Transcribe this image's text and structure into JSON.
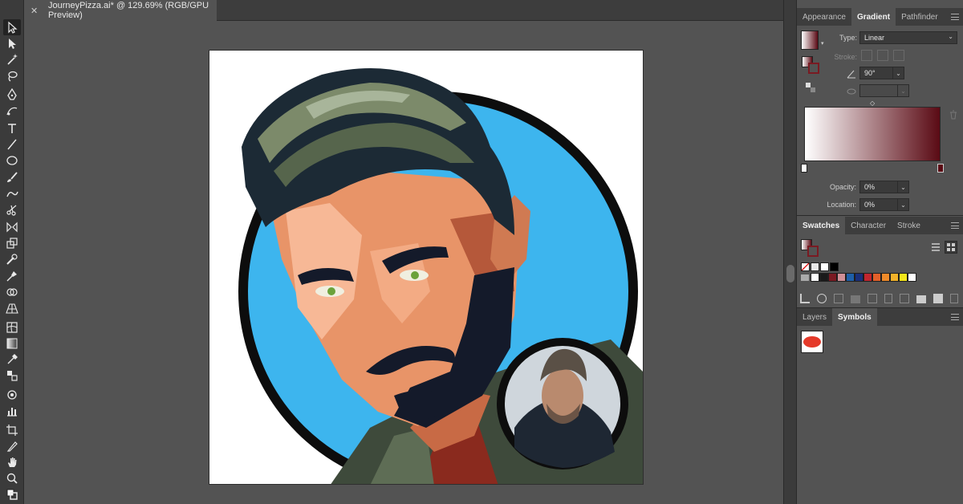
{
  "document": {
    "tab_title": "JourneyPizza.ai* @ 129.69% (RGB/GPU Preview)",
    "close_glyph": "✕"
  },
  "toolbar": {
    "tools": [
      "selection-tool-icon",
      "direct-selection-tool-icon",
      "magic-wand-tool-icon",
      "lasso-tool-icon",
      "pen-tool-icon",
      "curvature-tool-icon",
      "type-tool-icon",
      "line-segment-tool-icon",
      "ellipse-tool-icon",
      "paintbrush-tool-icon",
      "shaper-tool-icon",
      "scissors-tool-icon",
      "rotate-tool-icon",
      "scale-tool-icon",
      "warp-tool-icon",
      "puppet-warp-tool-icon",
      "shape-builder-tool-icon",
      "perspective-grid-tool-icon",
      "mesh-tool-icon",
      "gradient-tool-icon",
      "eyedropper-tool-icon",
      "blend-tool-icon",
      "symbol-sprayer-tool-icon",
      "column-graph-tool-icon",
      "artboard-tool-icon",
      "slice-tool-icon",
      "hand-tool-icon",
      "zoom-tool-icon"
    ]
  },
  "panels": {
    "top_tabs": [
      {
        "label": "Appearance"
      },
      {
        "label": "Gradient"
      },
      {
        "label": "Pathfinder"
      }
    ],
    "gradient": {
      "type_label": "Type:",
      "type_value": "Linear",
      "stroke_label": "Stroke:",
      "angle_value": "90°",
      "opacity_label": "Opacity:",
      "opacity_value": "0%",
      "location_label": "Location:",
      "location_value": "0%",
      "colors": {
        "start": "#ffffff",
        "end": "#5a0a14"
      }
    },
    "swatch_tabs": [
      {
        "label": "Swatches"
      },
      {
        "label": "Character"
      },
      {
        "label": "Stroke"
      }
    ],
    "swatch_colors": [
      "#ffffff",
      "#1a1a1a",
      "#7a1a22",
      "#d08f96",
      "#1e5fa8",
      "#1a2f7a",
      "#c2262e",
      "#e2602a",
      "#ee8a2a",
      "#f2b22a",
      "#f5e61a",
      "#ffffff"
    ],
    "layer_tabs": [
      {
        "label": "Layers"
      },
      {
        "label": "Symbols"
      }
    ],
    "symbol_color": "#e53a2a"
  }
}
